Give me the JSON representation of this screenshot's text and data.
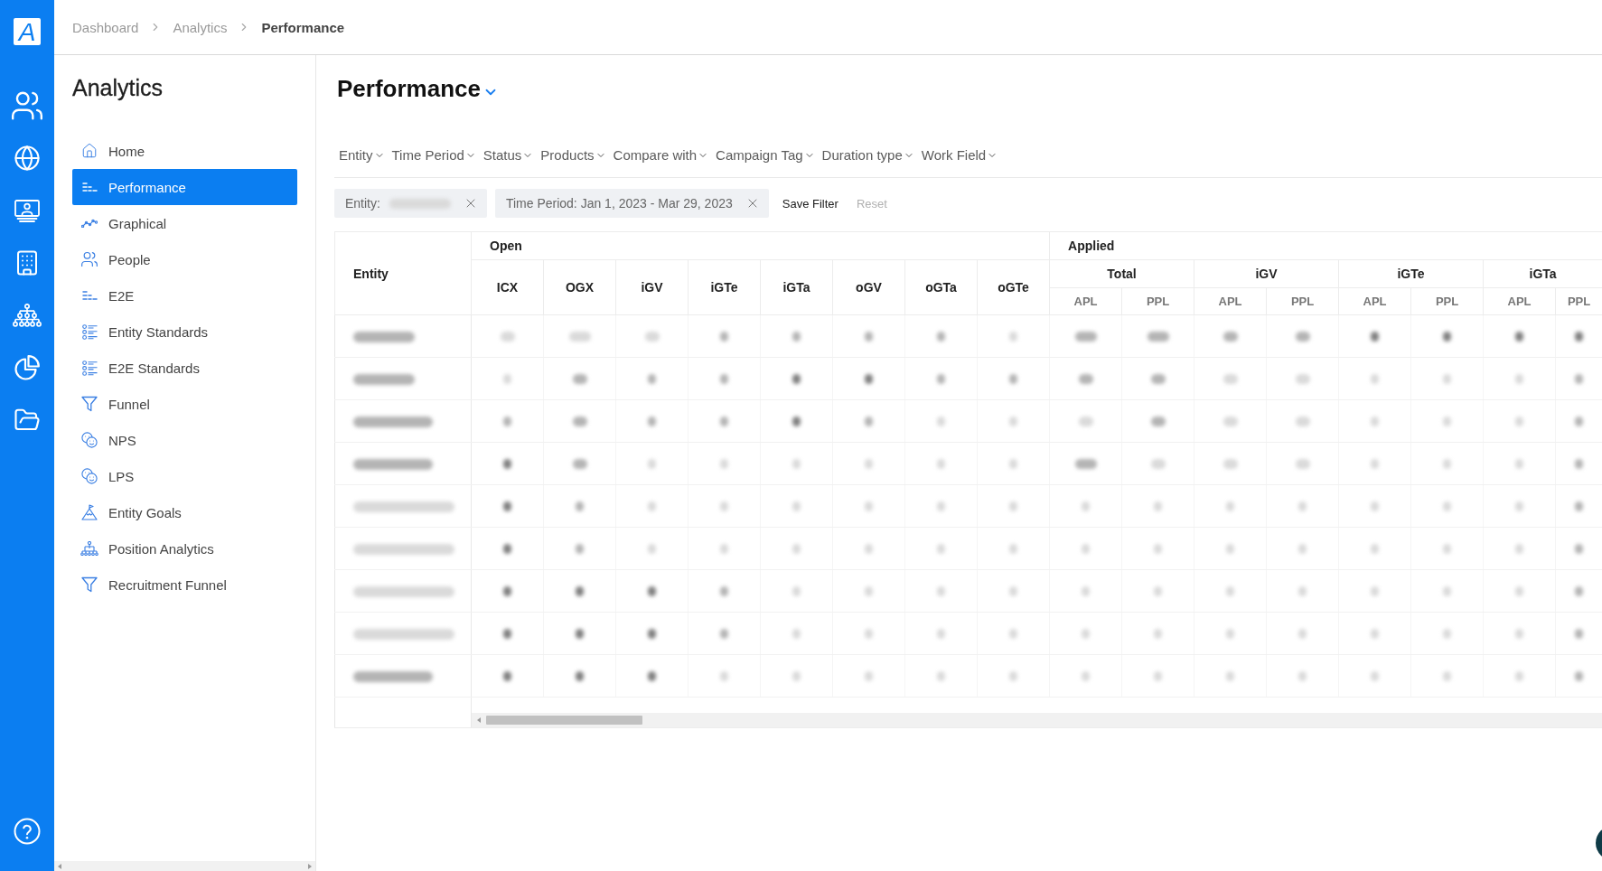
{
  "app": {
    "logo": "A"
  },
  "breadcrumb": [
    {
      "label": "Dashboard",
      "current": false
    },
    {
      "label": "Analytics",
      "current": false
    },
    {
      "label": "Performance",
      "current": true
    }
  ],
  "sidebar": {
    "title": "Analytics",
    "items": [
      {
        "label": "Home",
        "selected": false
      },
      {
        "label": "Performance",
        "selected": true
      },
      {
        "label": "Graphical",
        "selected": false
      },
      {
        "label": "People",
        "selected": false
      },
      {
        "label": "E2E",
        "selected": false
      },
      {
        "label": "Entity Standards",
        "selected": false
      },
      {
        "label": "E2E Standards",
        "selected": false
      },
      {
        "label": "Funnel",
        "selected": false
      },
      {
        "label": "NPS",
        "selected": false
      },
      {
        "label": "LPS",
        "selected": false
      },
      {
        "label": "Entity Goals",
        "selected": false
      },
      {
        "label": "Position Analytics",
        "selected": false
      },
      {
        "label": "Recruitment Funnel",
        "selected": false
      }
    ]
  },
  "page": {
    "title": "Performance"
  },
  "filters": [
    "Entity",
    "Time Period",
    "Status",
    "Products",
    "Compare with",
    "Campaign Tag",
    "Duration type",
    "Work Field"
  ],
  "active_filters": [
    {
      "label": "Entity:",
      "blurred_value": {
        "kind": "light-l"
      }
    },
    {
      "label": "Time Period: Jan 1, 2023 - Mar 29, 2023"
    }
  ],
  "filter_actions": [
    {
      "label": "Save Filter",
      "disabled": false
    },
    {
      "label": "Reset",
      "disabled": true
    }
  ],
  "table": {
    "entity_header": "Entity",
    "groups": [
      {
        "label": "Open",
        "columns": [
          "ICX",
          "OGX",
          "iGV",
          "iGTe",
          "iGTa",
          "oGV",
          "oGTa",
          "oGTe"
        ]
      },
      {
        "label": "Applied",
        "subgroups": [
          {
            "label": "Total",
            "columns": [
              "APL",
              "PPL"
            ]
          },
          {
            "label": "iGV",
            "columns": [
              "APL",
              "PPL"
            ]
          },
          {
            "label": "iGTe",
            "columns": [
              "APL",
              "PPL"
            ]
          },
          {
            "label": "iGTa",
            "columns": [
              "APL",
              "PPL"
            ]
          }
        ]
      }
    ],
    "rows": [
      {
        "entity": {
          "kind": "medium-l"
        },
        "cells": [
          {
            "kind": "light-s"
          },
          {
            "kind": "light-m"
          },
          {
            "kind": "light-s"
          },
          {
            "kind": "medium-xs"
          },
          {
            "kind": "medium-xs"
          },
          {
            "kind": "medium-xs"
          },
          {
            "kind": "medium-xs"
          },
          {
            "kind": "light-xs"
          },
          {
            "kind": "medium-m"
          },
          {
            "kind": "medium-m"
          },
          {
            "kind": "medium-s"
          },
          {
            "kind": "medium-s"
          },
          {
            "kind": "dark-xs"
          },
          {
            "kind": "dark-xs"
          },
          {
            "kind": "dark-xs"
          },
          {
            "kind": "dark-xs"
          }
        ]
      },
      {
        "entity": {
          "kind": "medium-l"
        },
        "cells": [
          {
            "kind": "light-xs"
          },
          {
            "kind": "medium-s"
          },
          {
            "kind": "medium-xs"
          },
          {
            "kind": "medium-xs"
          },
          {
            "kind": "dark-xs"
          },
          {
            "kind": "dark-xs"
          },
          {
            "kind": "medium-xs"
          },
          {
            "kind": "medium-xs"
          },
          {
            "kind": "medium-s"
          },
          {
            "kind": "medium-s"
          },
          {
            "kind": "light-s"
          },
          {
            "kind": "light-s"
          },
          {
            "kind": "light-xs"
          },
          {
            "kind": "light-xs"
          },
          {
            "kind": "light-xs"
          },
          {
            "kind": "medium-xs"
          }
        ]
      },
      {
        "entity": {
          "kind": "medium-xl"
        },
        "cells": [
          {
            "kind": "medium-xs"
          },
          {
            "kind": "medium-s"
          },
          {
            "kind": "medium-xs"
          },
          {
            "kind": "medium-xs"
          },
          {
            "kind": "dark-xs"
          },
          {
            "kind": "medium-xs"
          },
          {
            "kind": "light-xs"
          },
          {
            "kind": "light-xs"
          },
          {
            "kind": "light-s"
          },
          {
            "kind": "medium-s"
          },
          {
            "kind": "light-s"
          },
          {
            "kind": "light-s"
          },
          {
            "kind": "light-xs"
          },
          {
            "kind": "light-xs"
          },
          {
            "kind": "light-xs"
          },
          {
            "kind": "medium-xs"
          }
        ]
      },
      {
        "entity": {
          "kind": "medium-xl"
        },
        "cells": [
          {
            "kind": "dark-xs"
          },
          {
            "kind": "medium-s"
          },
          {
            "kind": "light-xs"
          },
          {
            "kind": "light-xs"
          },
          {
            "kind": "light-xs"
          },
          {
            "kind": "light-xs"
          },
          {
            "kind": "light-xs"
          },
          {
            "kind": "light-xs"
          },
          {
            "kind": "medium-m"
          },
          {
            "kind": "light-s"
          },
          {
            "kind": "light-s"
          },
          {
            "kind": "light-s"
          },
          {
            "kind": "light-xs"
          },
          {
            "kind": "light-xs"
          },
          {
            "kind": "light-xs"
          },
          {
            "kind": "medium-xs"
          }
        ]
      },
      {
        "entity": {
          "kind": "light-xxl"
        },
        "cells": [
          {
            "kind": "dark-xs"
          },
          {
            "kind": "medium-xs"
          },
          {
            "kind": "light-xs"
          },
          {
            "kind": "light-xs"
          },
          {
            "kind": "light-xs"
          },
          {
            "kind": "light-xs"
          },
          {
            "kind": "light-xs"
          },
          {
            "kind": "light-xs"
          },
          {
            "kind": "light-xs"
          },
          {
            "kind": "light-xs"
          },
          {
            "kind": "light-xs"
          },
          {
            "kind": "light-xs"
          },
          {
            "kind": "light-xs"
          },
          {
            "kind": "light-xs"
          },
          {
            "kind": "light-xs"
          },
          {
            "kind": "medium-xs"
          }
        ]
      },
      {
        "entity": {
          "kind": "light-xxl"
        },
        "cells": [
          {
            "kind": "dark-xs"
          },
          {
            "kind": "medium-xs"
          },
          {
            "kind": "light-xs"
          },
          {
            "kind": "light-xs"
          },
          {
            "kind": "light-xs"
          },
          {
            "kind": "light-xs"
          },
          {
            "kind": "light-xs"
          },
          {
            "kind": "light-xs"
          },
          {
            "kind": "light-xs"
          },
          {
            "kind": "light-xs"
          },
          {
            "kind": "light-xs"
          },
          {
            "kind": "light-xs"
          },
          {
            "kind": "light-xs"
          },
          {
            "kind": "light-xs"
          },
          {
            "kind": "light-xs"
          },
          {
            "kind": "medium-xs"
          }
        ]
      },
      {
        "entity": {
          "kind": "light-xxl"
        },
        "cells": [
          {
            "kind": "dark-xs"
          },
          {
            "kind": "dark-xs"
          },
          {
            "kind": "dark-xs"
          },
          {
            "kind": "medium-xs"
          },
          {
            "kind": "light-xs"
          },
          {
            "kind": "light-xs"
          },
          {
            "kind": "light-xs"
          },
          {
            "kind": "light-xs"
          },
          {
            "kind": "light-xs"
          },
          {
            "kind": "light-xs"
          },
          {
            "kind": "light-xs"
          },
          {
            "kind": "light-xs"
          },
          {
            "kind": "light-xs"
          },
          {
            "kind": "light-xs"
          },
          {
            "kind": "light-xs"
          },
          {
            "kind": "medium-xs"
          }
        ]
      },
      {
        "entity": {
          "kind": "light-xxl"
        },
        "cells": [
          {
            "kind": "dark-xs"
          },
          {
            "kind": "dark-xs"
          },
          {
            "kind": "dark-xs"
          },
          {
            "kind": "medium-xs"
          },
          {
            "kind": "light-xs"
          },
          {
            "kind": "light-xs"
          },
          {
            "kind": "light-xs"
          },
          {
            "kind": "light-xs"
          },
          {
            "kind": "light-xs"
          },
          {
            "kind": "light-xs"
          },
          {
            "kind": "light-xs"
          },
          {
            "kind": "light-xs"
          },
          {
            "kind": "light-xs"
          },
          {
            "kind": "light-xs"
          },
          {
            "kind": "light-xs"
          },
          {
            "kind": "medium-xs"
          }
        ]
      },
      {
        "entity": {
          "kind": "medium-xl"
        },
        "cells": [
          {
            "kind": "dark-xs"
          },
          {
            "kind": "dark-xs"
          },
          {
            "kind": "dark-xs"
          },
          {
            "kind": "light-xs"
          },
          {
            "kind": "light-xs"
          },
          {
            "kind": "light-xs"
          },
          {
            "kind": "light-xs"
          },
          {
            "kind": "light-xs"
          },
          {
            "kind": "light-xs"
          },
          {
            "kind": "light-xs"
          },
          {
            "kind": "light-xs"
          },
          {
            "kind": "light-xs"
          },
          {
            "kind": "light-xs"
          },
          {
            "kind": "light-xs"
          },
          {
            "kind": "light-xs"
          },
          {
            "kind": "medium-xs"
          }
        ]
      }
    ]
  }
}
